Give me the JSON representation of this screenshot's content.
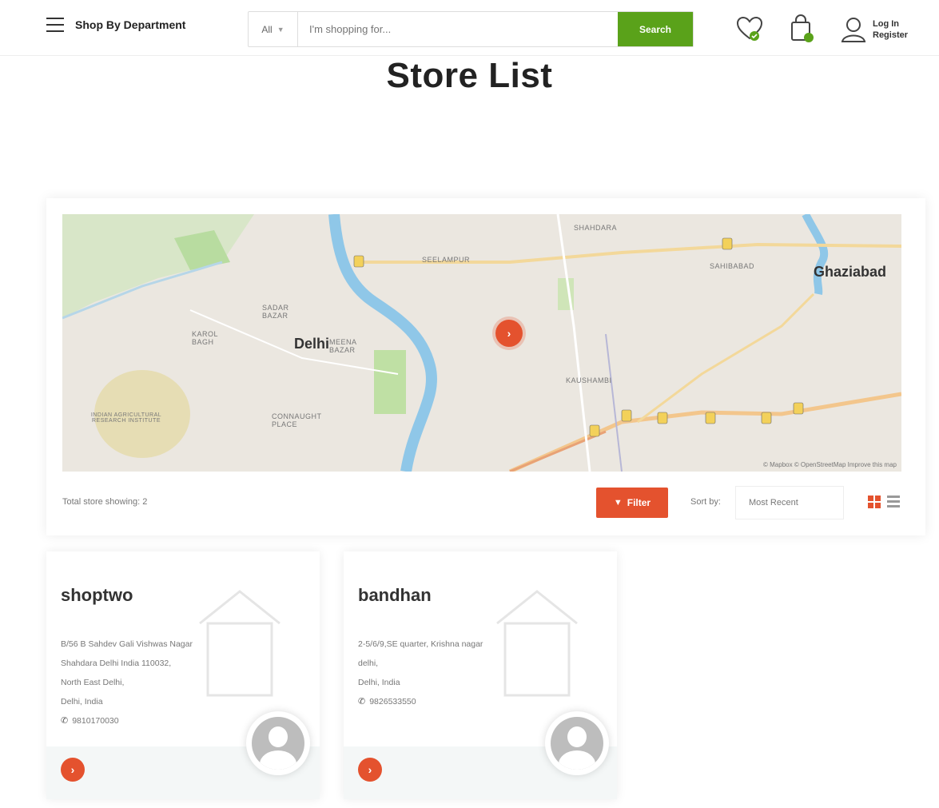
{
  "header": {
    "department_label": "Shop By Department",
    "search": {
      "category": "All",
      "placeholder": "I'm shopping for...",
      "button_label": "Search"
    },
    "account": {
      "login_label": "Log In",
      "register_label": "Register"
    }
  },
  "page": {
    "title": "Store List"
  },
  "map": {
    "labels": {
      "city_main": "Delhi",
      "city_east": "Ghaziabad",
      "area_1": "Sadar Bazar",
      "area_2": "Karol Bagh",
      "area_3": "Connaught Place",
      "area_4": "Meena Bazar",
      "area_5": "Seelampur",
      "area_6": "Sahibabad",
      "area_7": "Kaushambi",
      "area_8": "Shahdara",
      "area_9": "Indian Agricultural Research Institute"
    },
    "attribution": "© Mapbox © OpenStreetMap Improve this map"
  },
  "listing": {
    "total_text": "Total store showing: 2",
    "filter_label": "Filter",
    "sort_label": "Sort by:",
    "sort_value": "Most Recent"
  },
  "stores": [
    {
      "name": "shoptwo",
      "address_lines": [
        "B/56 B Sahdev Gali Vishwas Nagar",
        "Shahdara Delhi India 110032,",
        "North East Delhi,",
        "Delhi, India"
      ],
      "phone": "9810170030"
    },
    {
      "name": "bandhan",
      "address_lines": [
        "2-5/6/9,SE quarter, Krishna nagar",
        "delhi,",
        "Delhi, India"
      ],
      "phone": "9826533550"
    }
  ],
  "colors": {
    "accent": "#e4522e",
    "search_button": "#5aa21a"
  }
}
